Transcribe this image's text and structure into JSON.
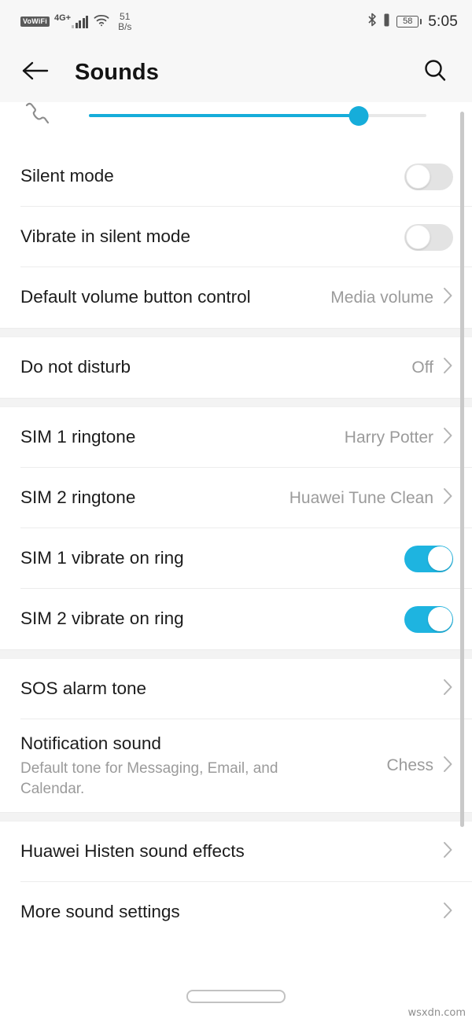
{
  "status_bar": {
    "vowifi_label": "VoWiFi",
    "network_label": "4G+",
    "signal_bars": 5,
    "wifi_icon": "wifi-icon",
    "network_speed_value": "51",
    "network_speed_unit": "B/s",
    "bluetooth_icon": "bluetooth-icon",
    "vibrate_icon": "vibrate-icon",
    "battery_percent": "58",
    "time": "5:05"
  },
  "header": {
    "back_icon": "back-arrow-icon",
    "title": "Sounds",
    "search_icon": "search-icon"
  },
  "volume_slider": {
    "icon": "call-volume-icon",
    "value_percent": 80,
    "fill_color": "#16adda",
    "track_color": "#e8e8e8"
  },
  "colors": {
    "accent": "#16adda",
    "toggle_on": "#1eb4e0",
    "toggle_off": "#e3e3e3",
    "section_gap": "#f3f3f3",
    "value_text": "#9b9b9b",
    "label_text": "#1c1c1c"
  },
  "sections": [
    {
      "rows": [
        {
          "label": "Silent mode",
          "type": "toggle",
          "state": "off"
        },
        {
          "label": "Vibrate in silent mode",
          "type": "toggle",
          "state": "off"
        },
        {
          "label": "Default volume button control",
          "type": "value",
          "value": "Media volume"
        }
      ]
    },
    {
      "rows": [
        {
          "label": "Do not disturb",
          "type": "value",
          "value": "Off"
        }
      ]
    },
    {
      "rows": [
        {
          "label": "SIM 1 ringtone",
          "type": "value",
          "value": "Harry Potter"
        },
        {
          "label": "SIM 2 ringtone",
          "type": "value",
          "value": "Huawei Tune Clean"
        },
        {
          "label": "SIM 1 vibrate on ring",
          "type": "toggle",
          "state": "on"
        },
        {
          "label": "SIM 2 vibrate on ring",
          "type": "toggle",
          "state": "on"
        }
      ]
    },
    {
      "rows": [
        {
          "label": "SOS alarm tone",
          "type": "value",
          "value": ""
        },
        {
          "label": "Notification sound",
          "sub": "Default tone for Messaging, Email, and Calendar.",
          "type": "value",
          "value": "Chess"
        }
      ]
    },
    {
      "rows": [
        {
          "label": "Huawei Histen sound effects",
          "type": "value",
          "value": ""
        },
        {
          "label": "More sound settings",
          "type": "value",
          "value": ""
        }
      ]
    }
  ],
  "nav_bar": {
    "home_pill": "home-gesture-pill"
  },
  "watermark": "wsxdn.com"
}
